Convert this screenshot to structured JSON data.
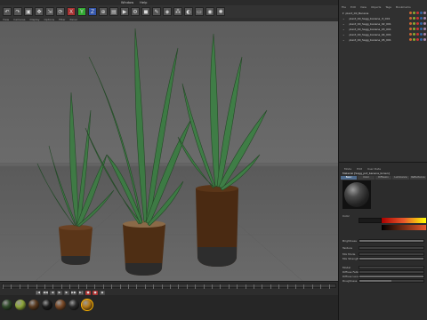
{
  "menubar": {
    "items": [
      "Window",
      "Help"
    ]
  },
  "toolbar": {
    "icons": [
      {
        "name": "undo-icon",
        "glyph": "↶"
      },
      {
        "name": "redo-icon",
        "glyph": "↷"
      },
      {
        "name": "select-icon",
        "glyph": "▣"
      },
      {
        "name": "move-icon",
        "glyph": "✥"
      },
      {
        "name": "scale-icon",
        "glyph": "⇲"
      },
      {
        "name": "rotate-icon",
        "glyph": "⟳"
      },
      {
        "name": "x-axis-icon",
        "glyph": "X"
      },
      {
        "name": "y-axis-icon",
        "glyph": "Y"
      },
      {
        "name": "z-axis-icon",
        "glyph": "Z"
      },
      {
        "name": "coord-icon",
        "glyph": "⊕"
      },
      {
        "name": "render-region-icon",
        "glyph": "▤"
      },
      {
        "name": "render-view-icon",
        "glyph": "▶"
      },
      {
        "name": "render-settings-icon",
        "glyph": "⚙"
      },
      {
        "name": "cube-icon",
        "glyph": "◼"
      },
      {
        "name": "pen-icon",
        "glyph": "✎"
      },
      {
        "name": "subdivide-icon",
        "glyph": "◈"
      },
      {
        "name": "array-icon",
        "glyph": "⁂"
      },
      {
        "name": "deformer-icon",
        "glyph": "◐"
      },
      {
        "name": "floor-icon",
        "glyph": "▭"
      },
      {
        "name": "camera-icon",
        "glyph": "◉"
      },
      {
        "name": "light-icon",
        "glyph": "✺"
      }
    ]
  },
  "viewport": {
    "menu": [
      "View",
      "Cameras",
      "Display",
      "Options",
      "Filter",
      "Panel"
    ]
  },
  "object_manager": {
    "menu": [
      "File",
      "Edit",
      "View",
      "Objects",
      "Tags",
      "Bookmarks"
    ],
    "objects": [
      "plant_00_Banana",
      "plant_00_Sagg_banana_rt_001",
      "plant_00_Sagg_banana_02_001",
      "plant_00_Sagg_banana_03_001",
      "plant_00_Sagg_banana_04_001",
      "plant_00_Sagg_banana_05_001"
    ]
  },
  "attributes": {
    "tabs": [
      "Mode",
      "Edit",
      "User Data"
    ],
    "material_name": "Material [Sagg_pot_banana_brown]",
    "channels": [
      "Basic",
      "Color",
      "Diffusion",
      "Luminance",
      "Reflectance"
    ],
    "rows": [
      {
        "label": "Color",
        "value": "Color"
      },
      {
        "label": "Brightness",
        "value": "100 %"
      },
      {
        "label": "Texture",
        "value": "Texture"
      },
      {
        "label": "Mix Mode",
        "value": "Normal"
      },
      {
        "label": "Mix Strength",
        "value": "100 %"
      },
      {
        "label": "Model",
        "value": "Lambertian"
      },
      {
        "label": "Diffuse Falloff",
        "value": "0 %"
      },
      {
        "label": "Diffuse Level",
        "value": "100 %"
      },
      {
        "label": "Roughness",
        "value": "50 %"
      }
    ],
    "accent": "#e8582a"
  },
  "timeline": {
    "frame_start": "0 F",
    "frame_end": "90 F"
  },
  "materials": [
    {
      "name": "mat-dark-green",
      "color": "#2f4a2a"
    },
    {
      "name": "mat-light-green",
      "color": "#8ea63a"
    },
    {
      "name": "mat-brown",
      "color": "#5a3a1f"
    },
    {
      "name": "mat-dark",
      "color": "#1d1d1d"
    },
    {
      "name": "mat-wood",
      "color": "#7a4a28"
    },
    {
      "name": "mat-black",
      "color": "#2a2a2a"
    },
    {
      "name": "mat-amber",
      "color": "#b57a18"
    }
  ]
}
